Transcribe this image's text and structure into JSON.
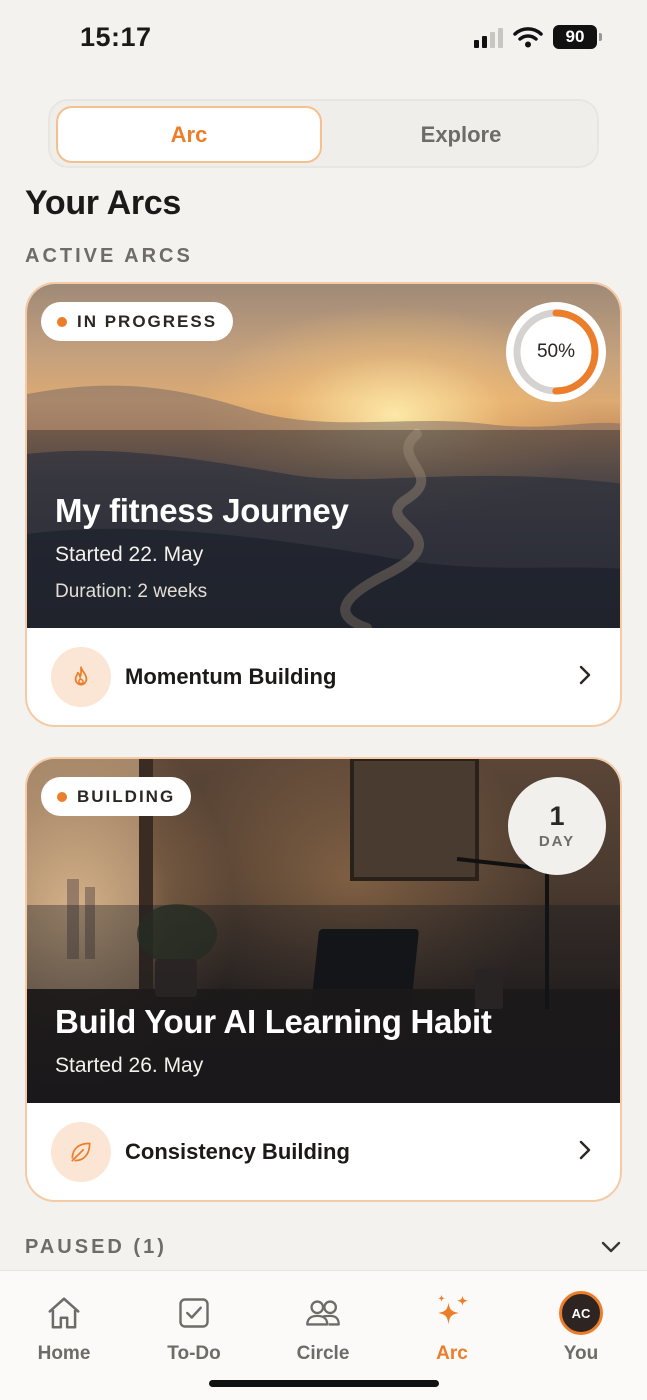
{
  "status_bar": {
    "time": "15:17",
    "battery": "90"
  },
  "segmented": {
    "active_label": "Arc",
    "inactive_label": "Explore"
  },
  "page_title": "Your Arcs",
  "active_section_label": "ACTIVE ARCS",
  "arcs": [
    {
      "status": "IN PROGRESS",
      "progress_percent": 50,
      "progress_label": "50%",
      "title": "My fitness Journey",
      "started": "Started 22. May",
      "duration": "Duration: 2 weeks",
      "footer_label": "Momentum Building",
      "footer_icon": "flame-icon"
    },
    {
      "status": "BUILDING",
      "day_count": "1",
      "day_unit": "DAY",
      "title": "Build Your AI Learning Habit",
      "started": "Started 26. May",
      "footer_label": "Consistency Building",
      "footer_icon": "leaf-icon"
    }
  ],
  "paused_label": "PAUSED (1)",
  "tabs": [
    {
      "label": "Home",
      "icon": "home-icon"
    },
    {
      "label": "To-Do",
      "icon": "checkbox-icon"
    },
    {
      "label": "Circle",
      "icon": "people-icon"
    },
    {
      "label": "Arc",
      "icon": "sparkles-icon",
      "active": true
    },
    {
      "label": "You",
      "avatar_initials": "AC"
    }
  ],
  "colors": {
    "accent": "#ec7d2a",
    "background": "#f4f2ef",
    "card_border": "#f5cba5"
  }
}
